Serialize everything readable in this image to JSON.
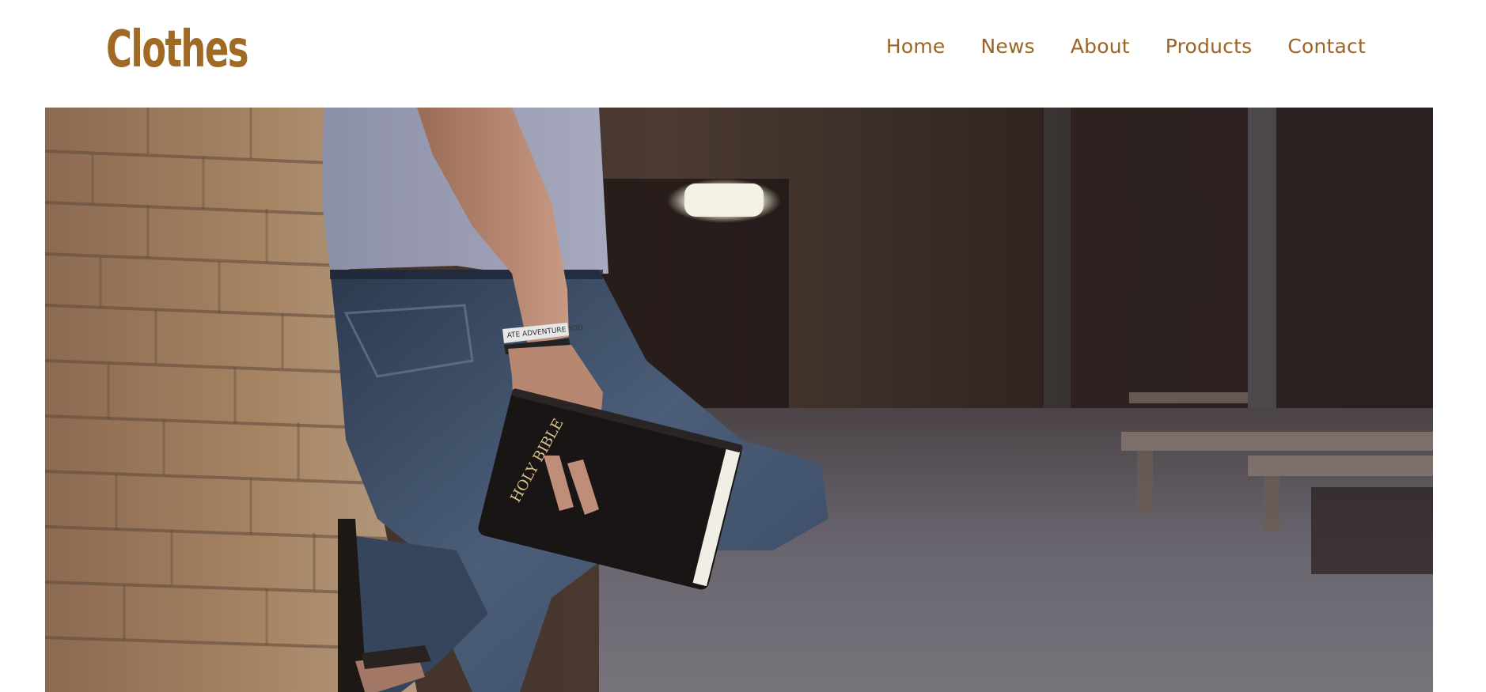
{
  "brand": {
    "name": "Clothes",
    "color": "#a06a24"
  },
  "nav": {
    "color": "#9b6424",
    "items": [
      {
        "label": "Home"
      },
      {
        "label": "News"
      },
      {
        "label": "About"
      },
      {
        "label": "Products"
      },
      {
        "label": "Contact"
      }
    ]
  },
  "hero": {
    "image_description": "man in grey t-shirt and jeans leaning against brick wall holding a book",
    "book_text": "HOLY BIBLE",
    "wristband_text": "ATE ADVENTURE YOU"
  }
}
